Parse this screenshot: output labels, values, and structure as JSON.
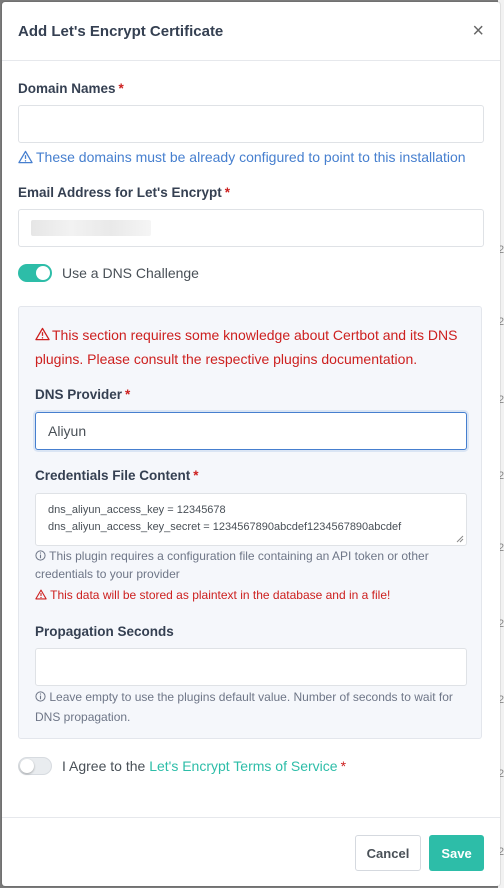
{
  "modal": {
    "title": "Add Let's Encrypt Certificate",
    "close_glyph": "×"
  },
  "domain_names": {
    "label": "Domain Names",
    "required_mark": "*",
    "value": "",
    "hint": "These domains must be already configured to point to this installation"
  },
  "email": {
    "label": "Email Address for Let's Encrypt",
    "required_mark": "*"
  },
  "dns_challenge": {
    "label": "Use a DNS Challenge",
    "enabled": true
  },
  "dns_section": {
    "warning": "This section requires some knowledge about Certbot and its DNS plugins. Please consult the respective plugins documentation.",
    "provider_label": "DNS Provider",
    "provider_required_mark": "*",
    "provider_value": "Aliyun",
    "credentials_label": "Credentials File Content",
    "credentials_required_mark": "*",
    "credentials_lines": [
      "dns_aliyun_access_key = 12345678",
      "dns_aliyun_access_key_secret = 1234567890abcdef1234567890abcdef"
    ],
    "credentials_info": "This plugin requires a configuration file containing an API token or other credentials to your provider",
    "credentials_warning": "This data will be stored as plaintext in the database and in a file!",
    "propagation_label": "Propagation Seconds",
    "propagation_value": "",
    "propagation_info": "Leave empty to use the plugins default value. Number of seconds to wait for DNS propagation."
  },
  "agree": {
    "prefix": "I Agree to the",
    "link": "Let's Encrypt Terms of Service",
    "required_mark": "*",
    "enabled": false
  },
  "footer": {
    "cancel_label": "Cancel",
    "save_label": "Save"
  },
  "colors": {
    "accent": "#2dbda8",
    "danger": "#cd201f",
    "info": "#467fcf"
  },
  "background_marks": [
    "2",
    "2",
    "2",
    "2",
    "2",
    "2",
    "2",
    "2",
    "2",
    "2"
  ]
}
